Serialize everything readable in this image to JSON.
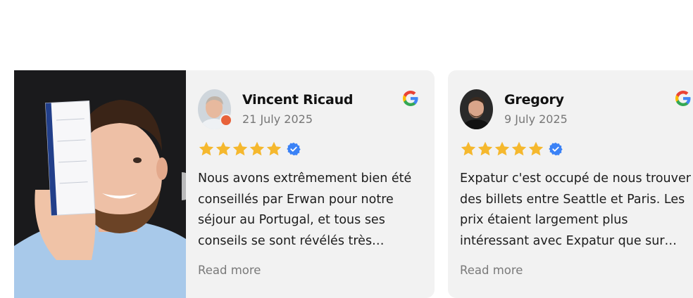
{
  "reviews": [
    {
      "name": "Vincent Ricaud",
      "date": "21 July 2025",
      "rating": 5,
      "text": "Nous avons extrêmement bien été conseillés par Erwan pour notre séjour au Portugal, et tous ses conseils se sont révélés très…",
      "read_more": "Read more",
      "source_icon": "google-g-icon"
    },
    {
      "name": "Gregory",
      "date": "9 July 2025",
      "rating": 5,
      "text": "Expatur c'est occupé de nous trouver des billets entre Seattle et Paris. Les prix étaient largement plus intéressant avec Expatur que sur…",
      "read_more": "Read more",
      "source_icon": "google-g-icon"
    }
  ],
  "colors": {
    "card_bg": "#f2f2f2",
    "star": "#f5b82e",
    "verified": "#3b82f6",
    "photo_bg": "#1a1a1c"
  }
}
